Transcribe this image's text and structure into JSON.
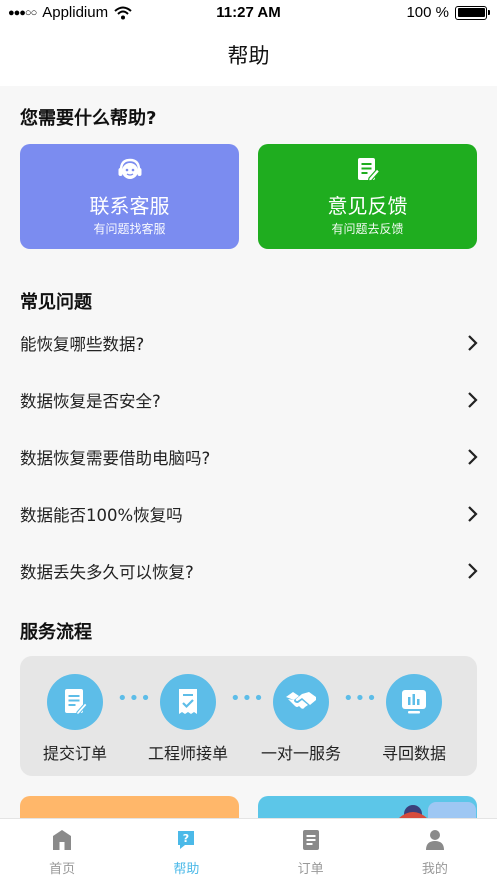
{
  "status_bar": {
    "signal": "●●●○○",
    "carrier": "Applidium",
    "time": "11:27 AM",
    "battery": "100 %"
  },
  "nav": {
    "title": "帮助"
  },
  "help": {
    "heading": "您需要什么帮助?",
    "cards": [
      {
        "title": "联系客服",
        "subtitle": "有问题找客服",
        "icon": "headset-icon",
        "color": "#7b8cf0"
      },
      {
        "title": "意见反馈",
        "subtitle": "有问题去反馈",
        "icon": "edit-note-icon",
        "color": "#1fad1f"
      }
    ]
  },
  "faq": {
    "heading": "常见问题",
    "items": [
      "能恢复哪些数据?",
      "数据恢复是否安全?",
      "数据恢复需要借助电脑吗?",
      "数据能否100%恢复吗",
      "数据丢失多久可以恢复?"
    ]
  },
  "process": {
    "heading": "服务流程",
    "steps": [
      {
        "label": "提交订单",
        "icon": "document-edit-icon"
      },
      {
        "label": "工程师接单",
        "icon": "receipt-check-icon"
      },
      {
        "label": "一对一服务",
        "icon": "handshake-icon"
      },
      {
        "label": "寻回数据",
        "icon": "chart-board-icon"
      }
    ],
    "accent": "#5dbde8"
  },
  "tabs": [
    {
      "label": "首页",
      "icon": "home-icon",
      "active": false
    },
    {
      "label": "帮助",
      "icon": "help-icon",
      "active": true
    },
    {
      "label": "订单",
      "icon": "order-icon",
      "active": false
    },
    {
      "label": "我的",
      "icon": "user-icon",
      "active": false
    }
  ],
  "colors": {
    "tab_active": "#4bb9e8",
    "tab_inactive": "#999999"
  }
}
